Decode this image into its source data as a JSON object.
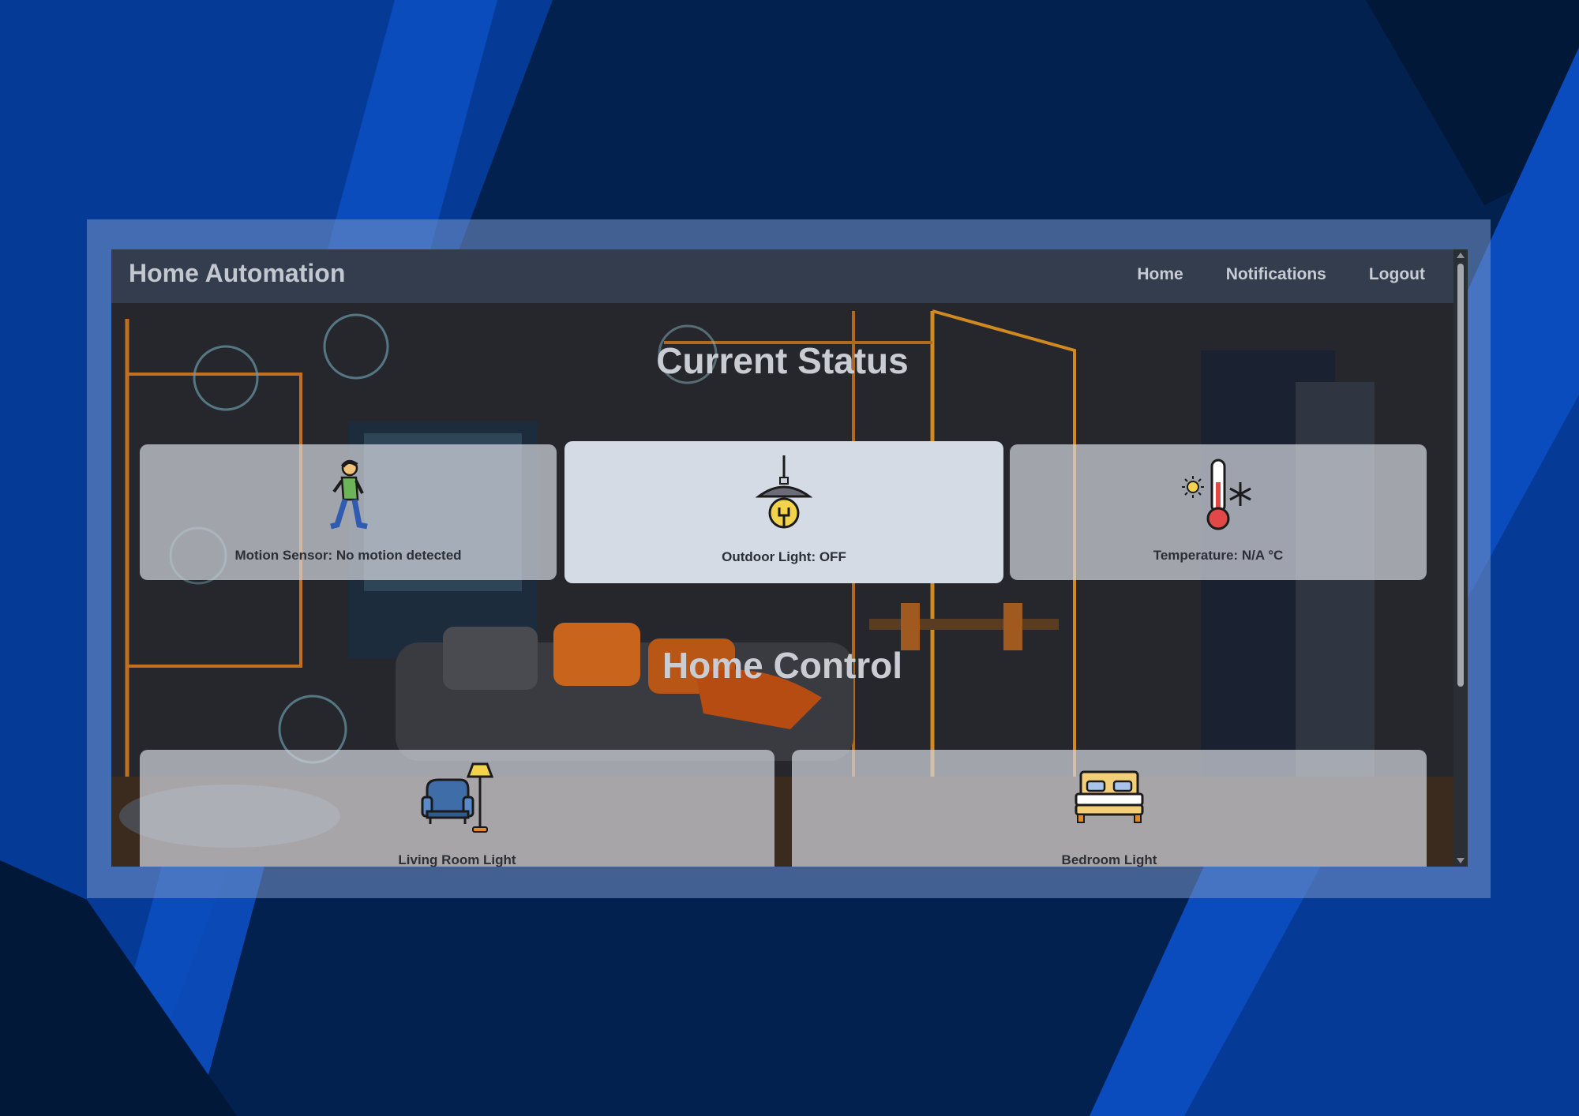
{
  "app": {
    "title": "Home Automation"
  },
  "nav": {
    "items": [
      "Home",
      "Notifications",
      "Logout"
    ]
  },
  "status_section": {
    "title": "Current Status",
    "cards": [
      {
        "label": "Motion Sensor: No motion detected",
        "icon": "walking-person-icon"
      },
      {
        "label": "Outdoor Light: OFF",
        "icon": "hanging-lamp-icon",
        "active": true
      },
      {
        "label": "Temperature: N/A °C",
        "icon": "thermometer-icon"
      }
    ]
  },
  "control_section": {
    "title": "Home Control",
    "cards": [
      {
        "label": "Living Room Light",
        "icon": "armchair-floor-lamp-icon"
      },
      {
        "label": "Bedroom Light",
        "icon": "bed-icon"
      }
    ]
  },
  "colors": {
    "navbar": "#343d4d",
    "page_background": "#02214f",
    "accent_blue": "#0a4db5"
  }
}
